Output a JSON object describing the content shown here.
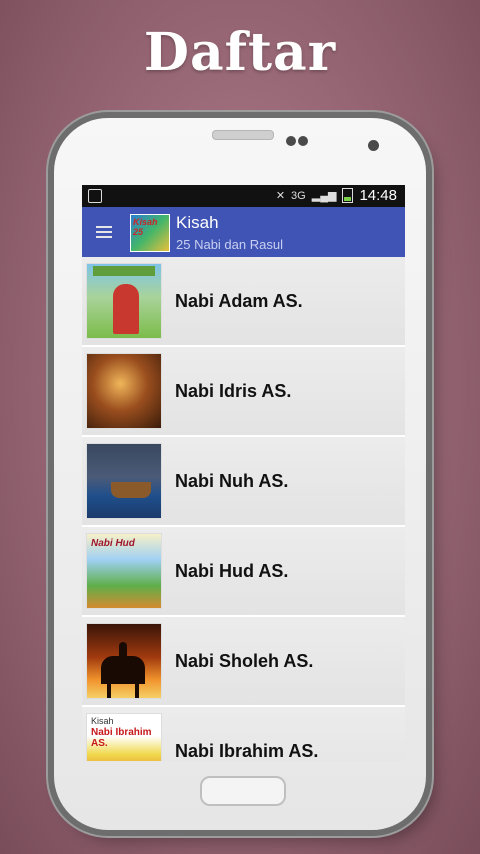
{
  "headline": "Daftar",
  "status_bar": {
    "network": "3G",
    "time": "14:48"
  },
  "app_bar": {
    "title": "Kisah",
    "subtitle": "25 Nabi dan Rasul",
    "logo_text": "Kisah 25"
  },
  "list": {
    "items": [
      {
        "label": "Nabi Adam AS."
      },
      {
        "label": "Nabi Idris AS."
      },
      {
        "label": "Nabi Nuh AS."
      },
      {
        "label": "Nabi Hud AS."
      },
      {
        "label": "Nabi Sholeh AS."
      },
      {
        "label": "Nabi Ibrahim AS."
      }
    ],
    "thumb_texts": {
      "hud": "Nabi Hud",
      "ibrahim_small": "Kisah",
      "ibrahim_title": "Nabi Ibrahim AS."
    }
  },
  "colors": {
    "app_bar": "#3f54b5",
    "background": "#9b6a78"
  }
}
